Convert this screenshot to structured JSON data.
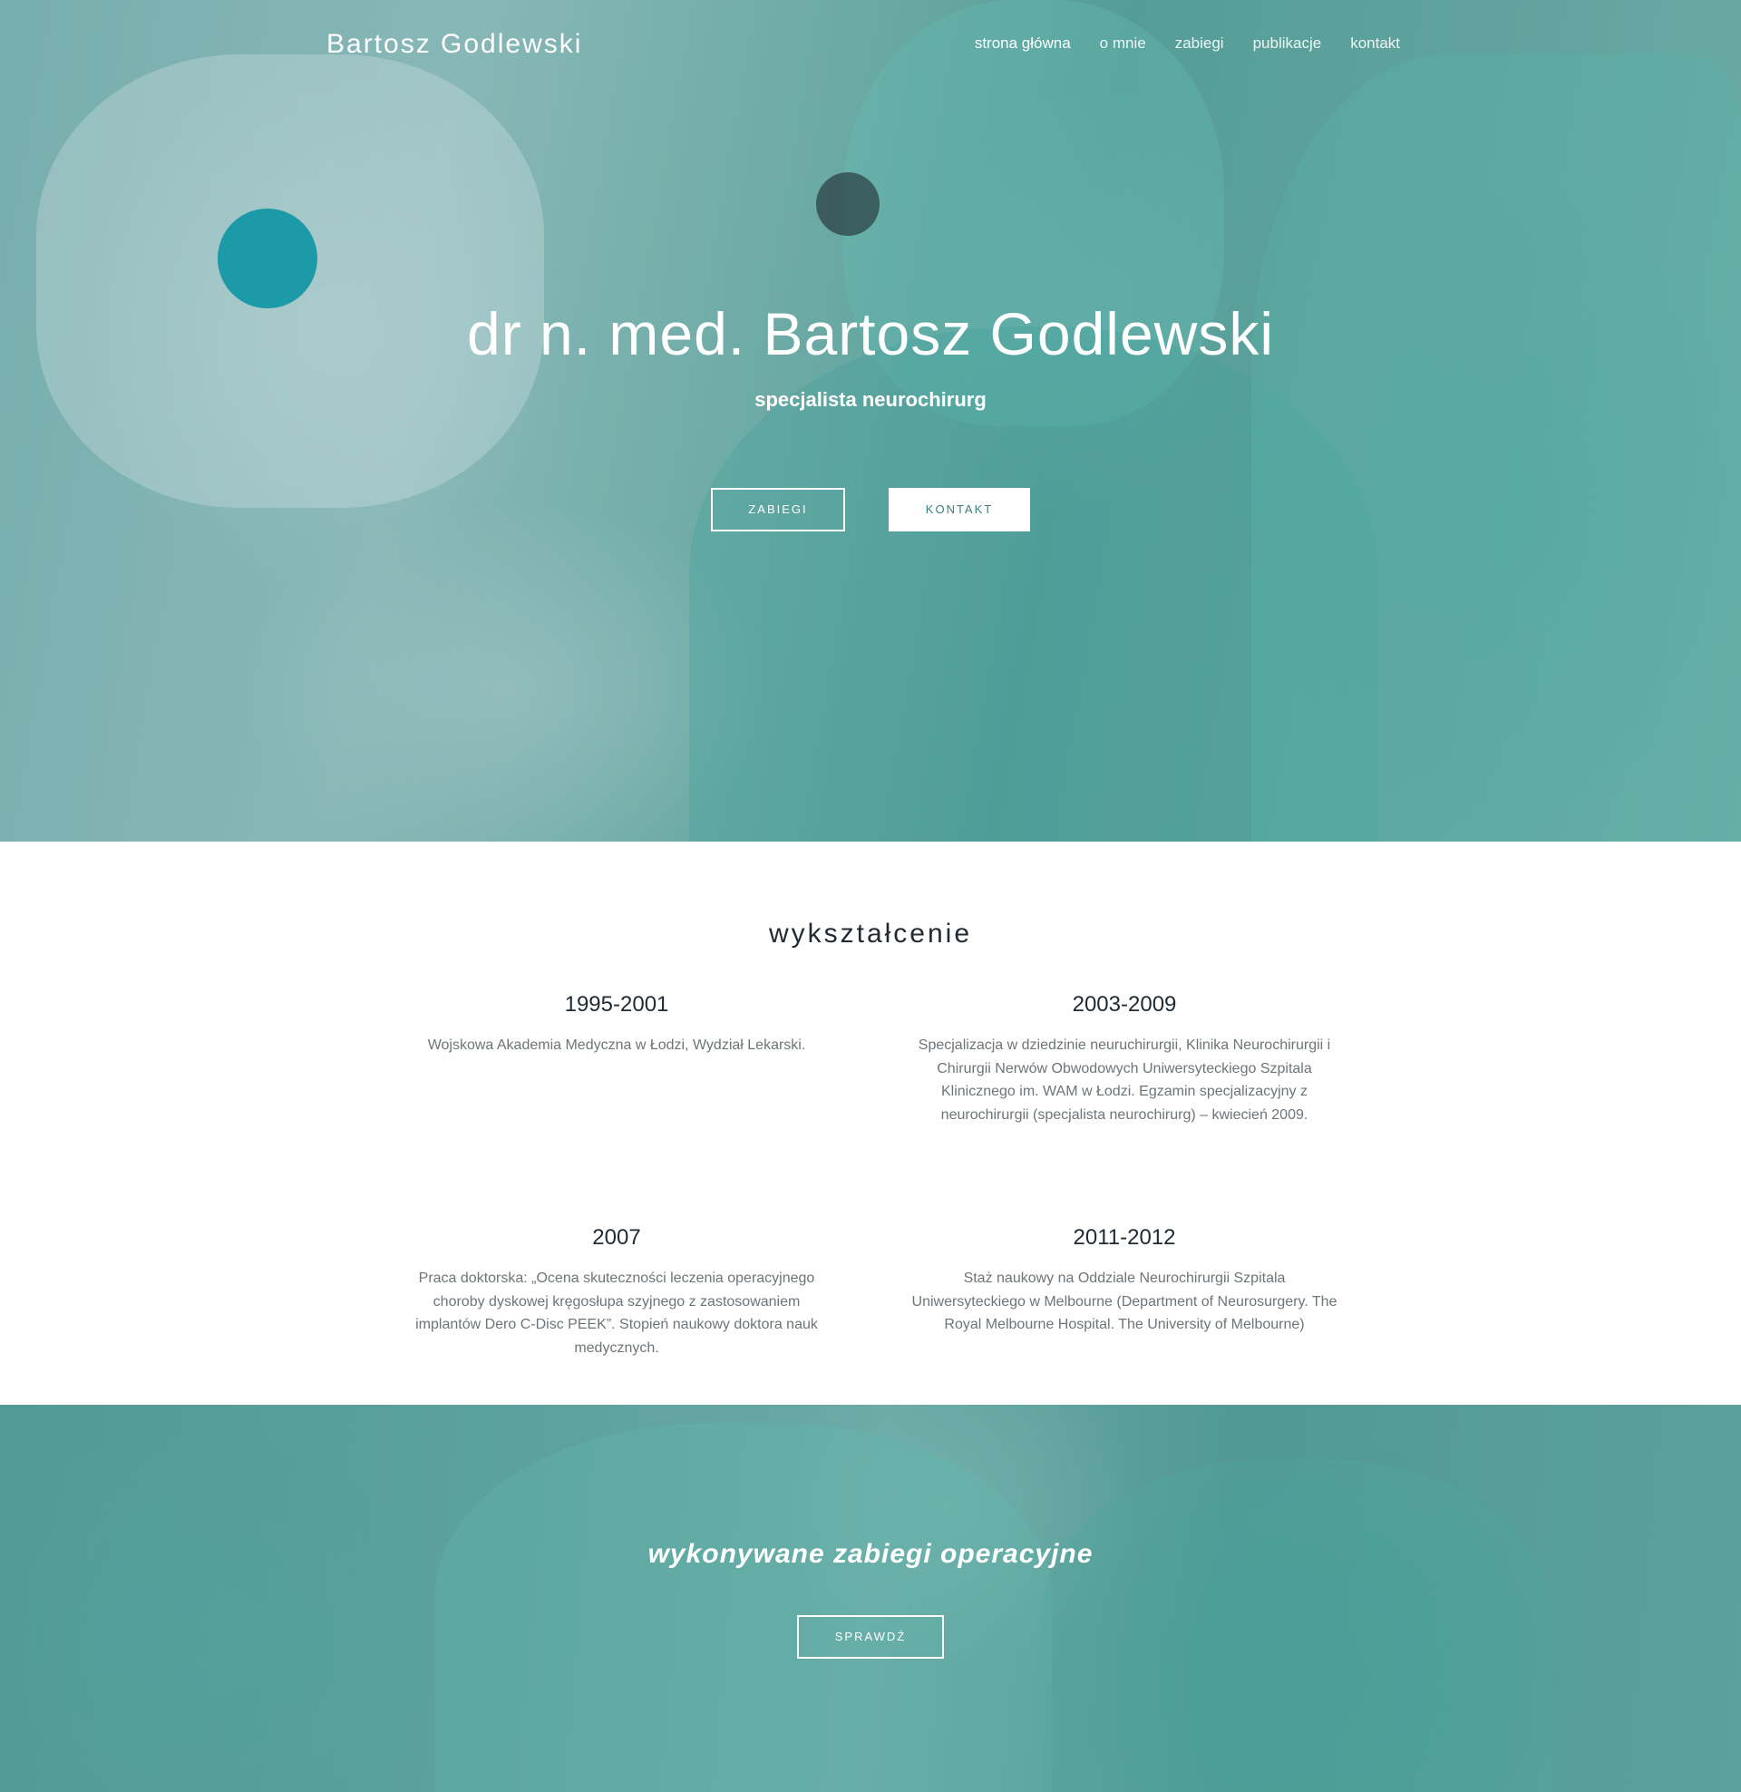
{
  "nav": {
    "brand": "Bartosz Godlewski",
    "items": [
      {
        "label": "strona główna"
      },
      {
        "label": "o mnie"
      },
      {
        "label": "zabiegi"
      },
      {
        "label": "publikacje"
      },
      {
        "label": "kontakt"
      }
    ]
  },
  "hero": {
    "title": "dr n. med. Bartosz Godlewski",
    "subtitle": "specjalista neurochirurg",
    "button_primary": "ZABIEGI",
    "button_secondary": "KONTAKT"
  },
  "education": {
    "title": "wykształcenie",
    "items": [
      {
        "year": "1995-2001",
        "text": "Wojskowa Akademia Medyczna w Łodzi, Wydział Lekarski."
      },
      {
        "year": "2003-2009",
        "text": "Specjalizacja w dziedzinie neuruchirurgii, Klinika Neurochirurgii i Chirurgii Nerwów Obwodowych Uniwersyteckiego Szpitala Klinicznego im. WAM w Łodzi. Egzamin specjalizacyjny z neurochirurgii (specjalista neurochirurg) – kwiecień 2009."
      },
      {
        "year": "2007",
        "text": "Praca doktorska: „Ocena skuteczności leczenia operacyjnego choroby dyskowej kręgosłupa szyjnego z zastosowaniem implantów Dero C-Disc PEEK”. Stopień naukowy doktora nauk medycznych."
      },
      {
        "year": "2011-2012",
        "text": "Staż naukowy na Oddziale Neurochirurgii Szpitala Uniwersyteckiego w Melbourne (Department of Neurosurgery. The Royal Melbourne Hospital. The University of Melbourne)"
      }
    ]
  },
  "cta": {
    "title": "wykonywane zabiegi operacyjne",
    "button": "SPRAWDŹ"
  },
  "colors": {
    "accent_teal": "#3b7f7e",
    "text_dark": "#1f2a33",
    "text_muted": "#6e7478"
  }
}
